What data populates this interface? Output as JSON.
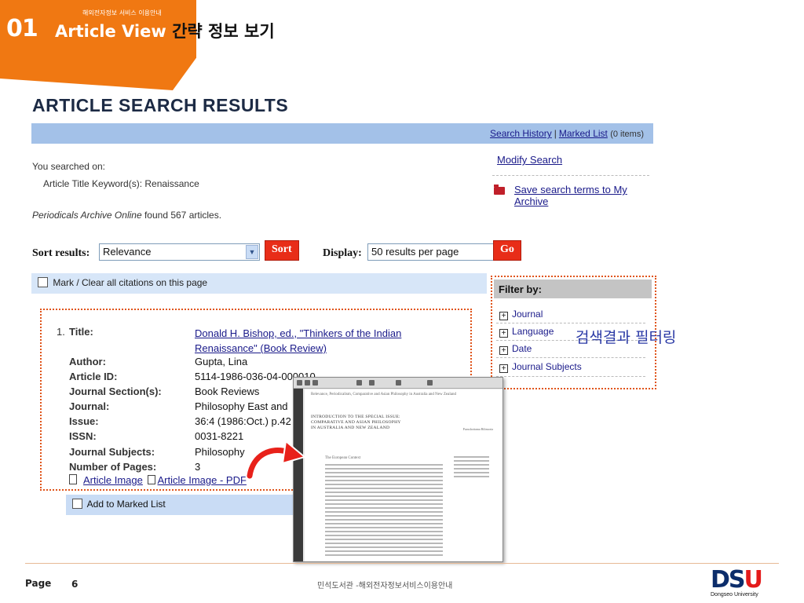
{
  "slide": {
    "number": "01",
    "subtitle": "해외전자정보 서비스 이용안내",
    "title_en": "Article View",
    "title_ko": "간략 정보 보기"
  },
  "results": {
    "heading": "ARTICLE SEARCH RESULTS",
    "search_history": "Search History",
    "separator": "|",
    "marked_list": "Marked List",
    "marked_count": "(0 items)",
    "searched_on": "You searched on:",
    "query": "Article Title Keyword(s): Renaissance",
    "found_source": "Periodicals Archive Online",
    "found_text": "found 567 articles."
  },
  "side_links": {
    "modify_search": "Modify Search",
    "save_search": "Save search terms to My Archive"
  },
  "controls": {
    "sort_label": "Sort results:",
    "sort_value": "Relevance",
    "sort_button": "Sort",
    "display_label": "Display:",
    "display_value": "50 results per page",
    "go_button": "Go"
  },
  "mark_all": "Mark / Clear all citations on this page",
  "record": {
    "number": "1.",
    "fields": [
      {
        "label": "Title:",
        "value": "Donald H. Bishop, ed., \"Thinkers of the Indian Renaissance\" (Book Review)"
      },
      {
        "label": "Author:",
        "value": "Gupta, Lina"
      },
      {
        "label": "Article ID:",
        "value": "5114-1986-036-04-000010"
      },
      {
        "label": "Journal Section(s):",
        "value": "Book Reviews"
      },
      {
        "label": "Journal:",
        "value": "Philosophy East and"
      },
      {
        "label": "Issue:",
        "value": "36:4 (1986:Oct.) p.42"
      },
      {
        "label": "ISSN:",
        "value": "0031-8221"
      },
      {
        "label": "Journal Subjects:",
        "value": "Philosophy"
      },
      {
        "label": "Number of Pages:",
        "value": "3"
      }
    ],
    "article_image": "Article Image",
    "article_image_pdf": "Article Image - PDF",
    "add_to_marked": "Add to Marked List"
  },
  "filter": {
    "heading": "Filter by:",
    "items": [
      "Journal",
      "Language",
      "Date",
      "Journal Subjects"
    ],
    "caption": "검색결과 필터링"
  },
  "pdf_preview": {
    "header": "Relevance, Periodicalism, Comparative and Asian Philosophy in Australia and New Zealand",
    "intro_line1": "INTRODUCTION TO THE SPECIAL ISSUE:",
    "intro_line2": "COMPARATIVE AND ASIAN PHILOSOPHY",
    "intro_line3": "IN AUSTRALIA AND NEW ZEALAND",
    "author_note": "Purushottama Bilimoria",
    "section": "The European Context"
  },
  "footer": {
    "page_label": "Page",
    "page_number": "6",
    "center_text": "민석도서관 -해외전자정보서비스이용안내",
    "logo_letters_1": "DS",
    "logo_letters_2": "U",
    "logo_name": "Dongseo University"
  },
  "colors": {
    "accent_orange": "#f07812",
    "bar_blue": "#a3c1e8",
    "button_red": "#e82d18",
    "link_blue": "#1a1a8a"
  }
}
